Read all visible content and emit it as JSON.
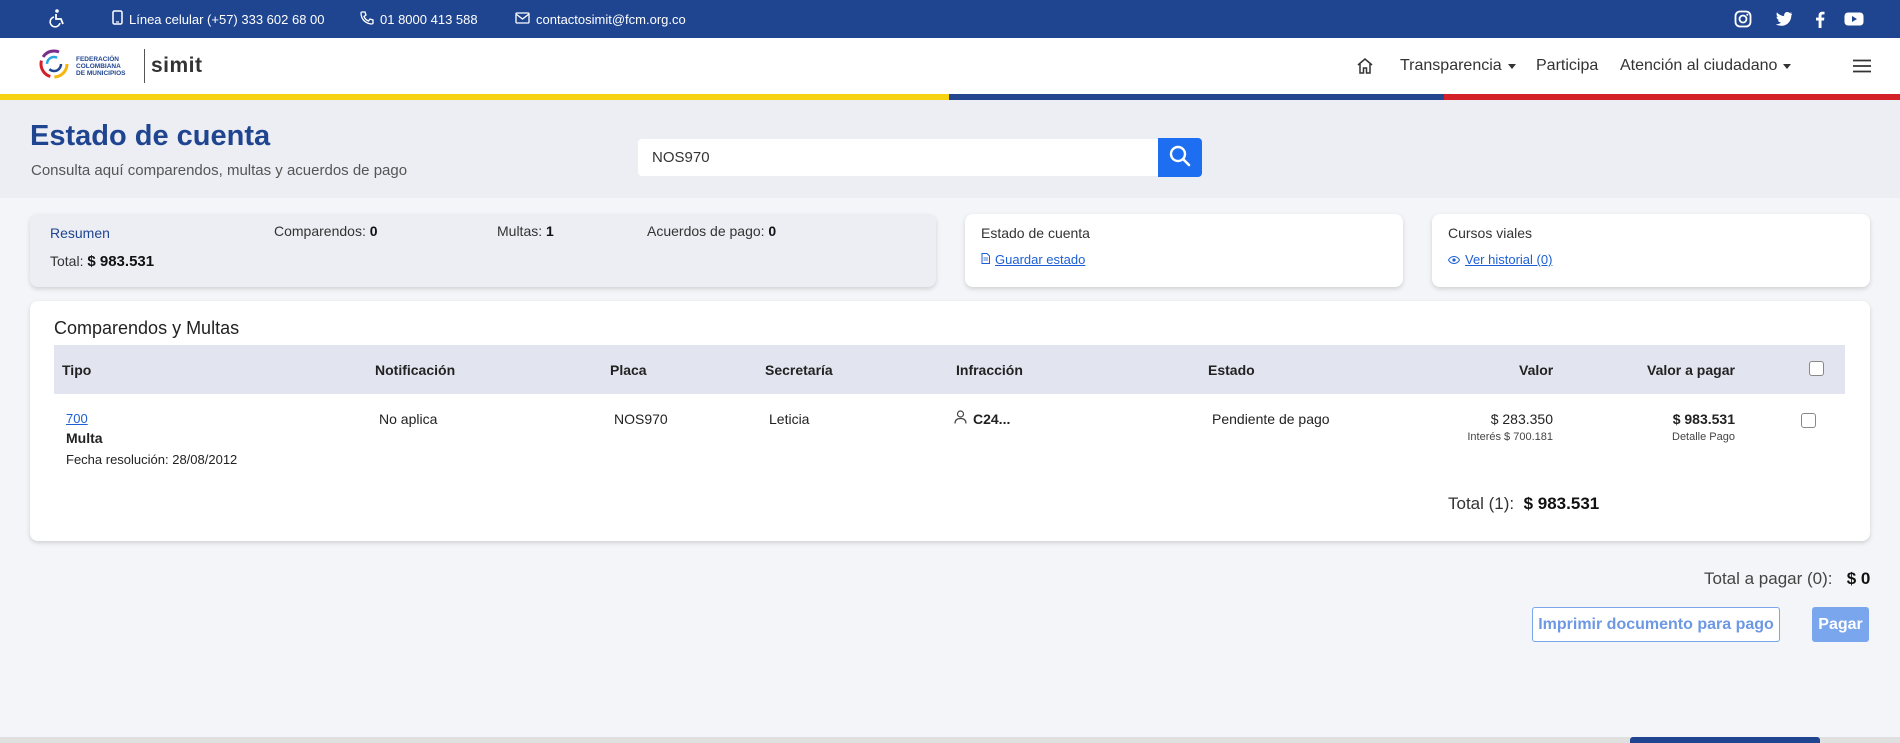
{
  "topbar": {
    "accessibility_icon": "wheelchair-icon",
    "phone": "Línea celular (+57) 333 602 68 00",
    "line": "01 8000 413 588",
    "email": "contactosimit@fcm.org.co",
    "social": [
      "instagram-icon",
      "twitter-icon",
      "facebook-icon",
      "youtube-icon"
    ]
  },
  "logo": {
    "org_line1": "FEDERACIÓN",
    "org_line2": "COLOMBIANA",
    "org_line3": "DE MUNICIPIOS",
    "brand": "simit"
  },
  "nav": {
    "home_icon": "home-icon",
    "transparencia": "Transparencia",
    "participa": "Participa",
    "atencion": "Atención al ciudadano",
    "menu_icon": "hamburger-icon"
  },
  "header": {
    "title": "Estado de cuenta",
    "subtitle": "Consulta aquí comparendos, multas y acuerdos de pago",
    "search_value": "NOS970"
  },
  "summary": {
    "title": "Resumen",
    "total_label": "Total:",
    "total_value": "$ 983.531",
    "comparendos_label": "Comparendos:",
    "comparendos_value": "0",
    "multas_label": "Multas:",
    "multas_value": "1",
    "acuerdos_label": "Acuerdos de pago:",
    "acuerdos_value": "0"
  },
  "estado_card": {
    "title": "Estado de cuenta",
    "link": "Guardar estado"
  },
  "cursos_card": {
    "title": "Cursos viales",
    "link": "Ver historial (0)"
  },
  "table": {
    "title": "Comparendos y Multas",
    "headers": {
      "tipo": "Tipo",
      "notificacion": "Notificación",
      "placa": "Placa",
      "secretaria": "Secretaría",
      "infraccion": "Infracción",
      "estado": "Estado",
      "valor": "Valor",
      "valor_pagar": "Valor a pagar"
    },
    "row": {
      "code": "700",
      "tipo": "Multa",
      "fecha": "Fecha resolución: 28/08/2012",
      "notificacion": "No aplica",
      "placa": "NOS970",
      "secretaria": "Leticia",
      "infraccion": "C24...",
      "estado": "Pendiente de pago",
      "valor": "$ 283.350",
      "interes": "Interés $ 700.181",
      "valor_pagar": "$ 983.531",
      "detalle": "Detalle Pago"
    },
    "total_label": "Total (1):",
    "total_value": "$ 983.531"
  },
  "footer": {
    "total_pagar_label": "Total a pagar (0):",
    "total_pagar_value": "$ 0",
    "print_button": "Imprimir documento para pago",
    "pay_button": "Pagar"
  },
  "colors": {
    "primary": "#1f4590",
    "accent": "#1d6ef1",
    "stripe_yellow": "#f5d312",
    "stripe_blue": "#24458f",
    "stripe_red": "#d42028"
  }
}
